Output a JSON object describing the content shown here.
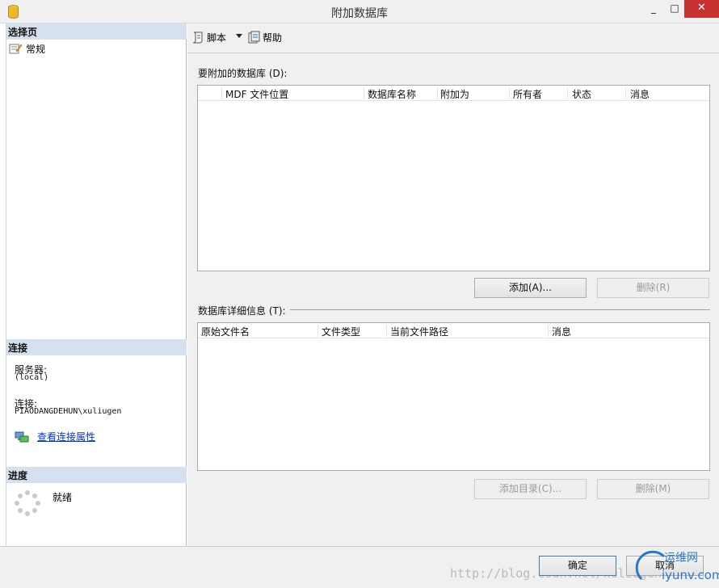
{
  "window": {
    "title": "附加数据库",
    "minimize": "_",
    "maximize": "□",
    "close": "✕"
  },
  "left": {
    "select_page_header": "选择页",
    "nav_general": "常规",
    "connection_header": "连接",
    "server_label": "服务器:",
    "server_value": "(local)",
    "connection_label": "连接:",
    "connection_value": "PIAODANGDEHUN\\xuliugen",
    "view_conn_link": "查看连接属性",
    "progress_header": "进度",
    "progress_status": "就绪"
  },
  "toolbar": {
    "script_label": "脚本",
    "help_label": "帮助"
  },
  "attach_section": {
    "label": "要附加的数据库 (D):",
    "columns": [
      "MDF 文件位置",
      "数据库名称",
      "附加为",
      "所有者",
      "状态",
      "消息"
    ],
    "add_button": "添加(A)...",
    "remove_button": "删除(R)"
  },
  "details_section": {
    "label": "数据库详细信息 (T):",
    "columns": [
      "原始文件名",
      "文件类型",
      "当前文件路径",
      "消息"
    ],
    "add_catalog_button": "添加目录(C)...",
    "remove_button": "删除(M)"
  },
  "footer": {
    "ok_button": "确定",
    "cancel_button": "取消",
    "watermark": "http://blog.csdn.net/xuliugen",
    "logo_text_top": "运维网",
    "logo_text_bottom": "iyunv.com"
  },
  "colors": {
    "section_header_bg": "#d5e1ee",
    "link": "#0033cc",
    "close_button": "#c7312f"
  }
}
